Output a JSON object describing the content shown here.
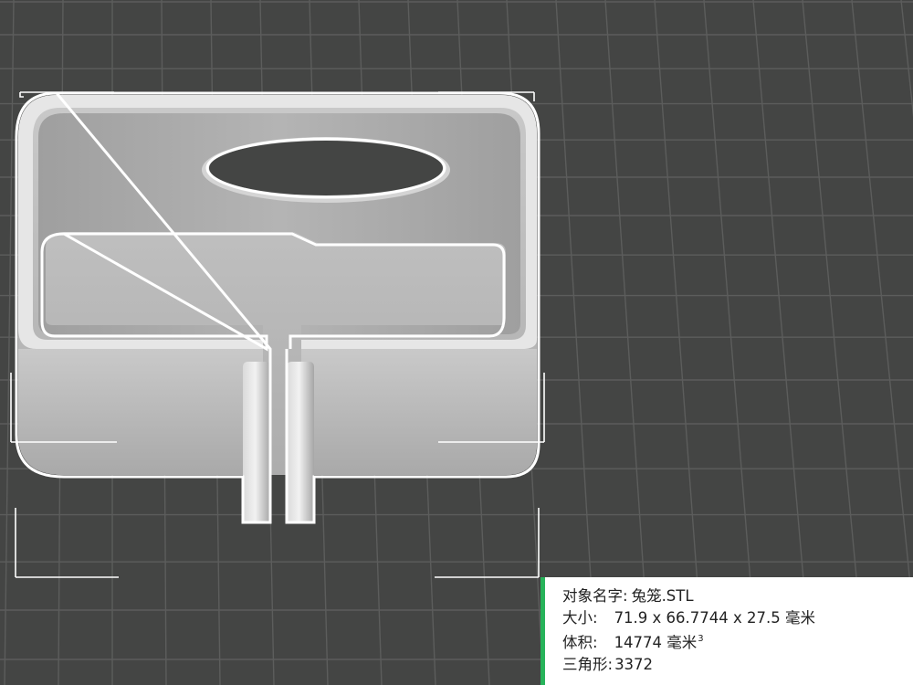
{
  "viewport": {
    "background_color": "#444544",
    "grid_color": "#5c5d5c",
    "model_color": "#b9b9b9",
    "outline_color": "#ffffff",
    "accent_color": "#27b35a"
  },
  "object_info": {
    "name_label": "对象名字:",
    "name_value": "兔笼.STL",
    "size_label": "大小:",
    "size_value": "71.9 x 66.7744 x 27.5 毫米",
    "volume_label": "体积:",
    "volume_value": "14774 毫米",
    "volume_exponent": "3",
    "triangles_label": "三角形:",
    "triangles_value": "3372"
  }
}
